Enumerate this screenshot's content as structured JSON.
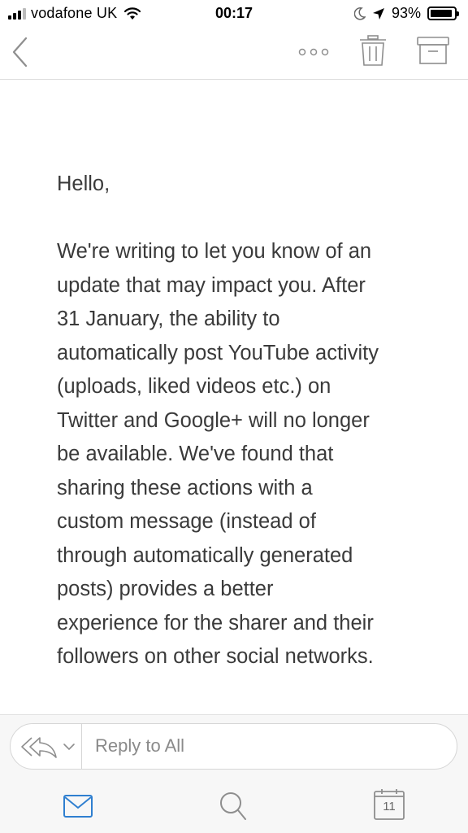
{
  "status_bar": {
    "carrier": "vodafone UK",
    "time": "00:17",
    "battery_percent": "93%",
    "battery_level": 0.93
  },
  "nav": {
    "back_icon": "chevron-left-icon",
    "more_icon": "more-dots-icon",
    "trash_icon": "trash-icon",
    "archive_icon": "archive-icon"
  },
  "email": {
    "greeting": "Hello,",
    "paragraph_lines": [
      "We're writing to let you know of an",
      "update that may impact you. After",
      "31 January, the ability to",
      "automatically post YouTube activity",
      "(uploads, liked videos etc.) on",
      "Twitter and Google+ will no longer",
      "be available. We've found that",
      "sharing these actions with a",
      "custom message (instead of",
      "through automatically generated",
      "posts) provides a better",
      "experience for the sharer and their",
      "followers on other social networks."
    ]
  },
  "reply": {
    "placeholder": "Reply to All"
  },
  "tabs": {
    "calendar_day": "11"
  },
  "colors": {
    "accent": "#2f7fd0",
    "icon_gray": "#8e8e8e",
    "text": "#3a3a3a"
  }
}
